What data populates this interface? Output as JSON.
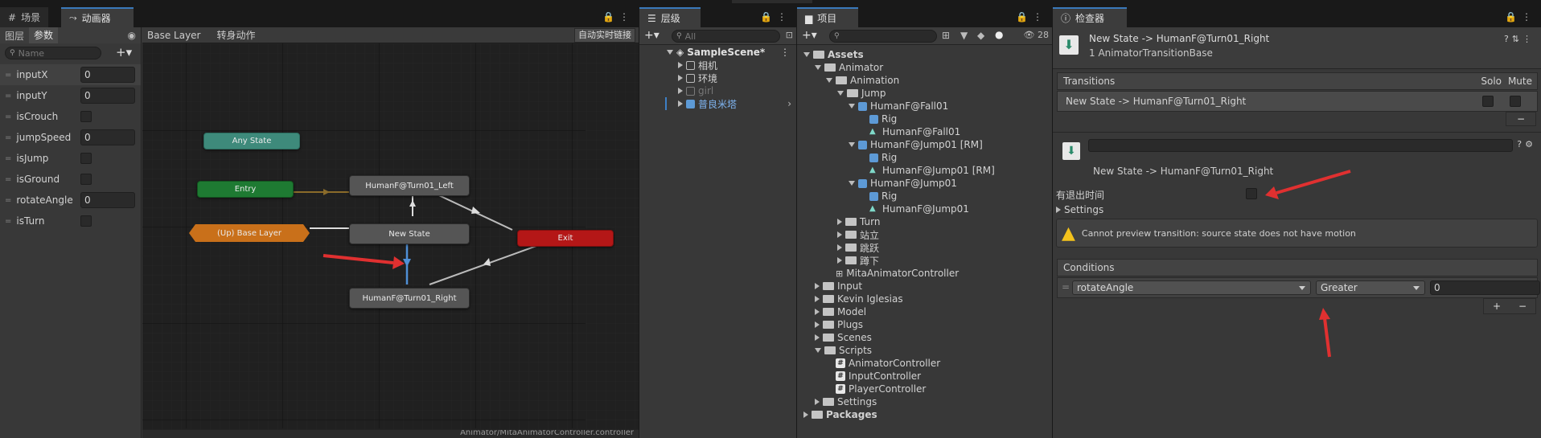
{
  "animator": {
    "tabs": [
      {
        "label": "场景"
      },
      {
        "label": "动画器"
      }
    ],
    "subtabs": {
      "layers": "图层",
      "params": "参数"
    },
    "search_placeholder": "Name",
    "params": [
      {
        "name": "inputX",
        "type": "float",
        "value": "0"
      },
      {
        "name": "inputY",
        "type": "float",
        "value": "0"
      },
      {
        "name": "isCrouch",
        "type": "bool",
        "value": ""
      },
      {
        "name": "jumpSpeed",
        "type": "float",
        "value": "0"
      },
      {
        "name": "isJump",
        "type": "bool",
        "value": ""
      },
      {
        "name": "isGround",
        "type": "bool",
        "value": ""
      },
      {
        "name": "rotateAngle",
        "type": "float",
        "value": "0"
      },
      {
        "name": "isTurn",
        "type": "bool",
        "value": ""
      }
    ],
    "breadcrumb": {
      "layer": "Base Layer",
      "state": "转身动作"
    },
    "live_link": "自动实时链接",
    "footer_path": "Animator/MitaAnimatorController.controller",
    "nodes": {
      "any_state": "Any State",
      "entry": "Entry",
      "up_base": "(Up) Base Layer",
      "turn_left": "HumanF@Turn01_Left",
      "new_state": "New State",
      "turn_right": "HumanF@Turn01_Right",
      "exit": "Exit"
    },
    "colors": {
      "any": "#3e8a7b",
      "entry": "#1e7a32",
      "up": "#c9701a",
      "exit": "#b41717",
      "state": "#555555",
      "selected": "#4f8fd6",
      "annotation": "#e03030"
    }
  },
  "hierarchy": {
    "tab": "层级",
    "search_placeholder": "All",
    "scene": "SampleScene*",
    "items": [
      {
        "label": "相机",
        "kind": "outline"
      },
      {
        "label": "环境",
        "kind": "outline"
      },
      {
        "label": "girl",
        "kind": "disabled"
      },
      {
        "label": "普良米塔",
        "kind": "prefab"
      }
    ]
  },
  "project": {
    "tab": "项目",
    "count": "28",
    "tree": [
      {
        "label": "Assets",
        "depth": 0,
        "icon": "folder",
        "expanded": true
      },
      {
        "label": "Animator",
        "depth": 1,
        "icon": "folder",
        "expanded": true
      },
      {
        "label": "Animation",
        "depth": 2,
        "icon": "folder",
        "expanded": true
      },
      {
        "label": "Jump",
        "depth": 3,
        "icon": "folder",
        "expanded": true
      },
      {
        "label": "HumanF@Fall01",
        "depth": 4,
        "icon": "cube",
        "expanded": true
      },
      {
        "label": "Rig",
        "depth": 5,
        "icon": "cube",
        "expanded": null
      },
      {
        "label": "HumanF@Fall01",
        "depth": 5,
        "icon": "anim",
        "expanded": null
      },
      {
        "label": "HumanF@Jump01 [RM]",
        "depth": 4,
        "icon": "cube",
        "expanded": true
      },
      {
        "label": "Rig",
        "depth": 5,
        "icon": "cube",
        "expanded": null
      },
      {
        "label": "HumanF@Jump01 [RM]",
        "depth": 5,
        "icon": "anim",
        "expanded": null
      },
      {
        "label": "HumanF@Jump01",
        "depth": 4,
        "icon": "cube",
        "expanded": true
      },
      {
        "label": "Rig",
        "depth": 5,
        "icon": "cube",
        "expanded": null
      },
      {
        "label": "HumanF@Jump01",
        "depth": 5,
        "icon": "anim",
        "expanded": null
      },
      {
        "label": "Turn",
        "depth": 3,
        "icon": "folder",
        "expanded": false
      },
      {
        "label": "站立",
        "depth": 3,
        "icon": "folder",
        "expanded": false
      },
      {
        "label": "跳跃",
        "depth": 3,
        "icon": "folder",
        "expanded": false
      },
      {
        "label": "蹲下",
        "depth": 3,
        "icon": "folder",
        "expanded": false
      },
      {
        "label": "MitaAnimatorController",
        "depth": 2,
        "icon": "controller",
        "expanded": null
      },
      {
        "label": "Input",
        "depth": 1,
        "icon": "folder",
        "expanded": false
      },
      {
        "label": "Kevin Iglesias",
        "depth": 1,
        "icon": "folder",
        "expanded": false
      },
      {
        "label": "Model",
        "depth": 1,
        "icon": "folder",
        "expanded": false
      },
      {
        "label": "Plugs",
        "depth": 1,
        "icon": "folder",
        "expanded": false
      },
      {
        "label": "Scenes",
        "depth": 1,
        "icon": "folder",
        "expanded": false
      },
      {
        "label": "Scripts",
        "depth": 1,
        "icon": "folder",
        "expanded": true
      },
      {
        "label": "AnimatorController",
        "depth": 2,
        "icon": "script",
        "expanded": null
      },
      {
        "label": "InputController",
        "depth": 2,
        "icon": "script",
        "expanded": null
      },
      {
        "label": "PlayerController",
        "depth": 2,
        "icon": "script",
        "expanded": null
      },
      {
        "label": "Settings",
        "depth": 1,
        "icon": "folder",
        "expanded": false
      },
      {
        "label": "Packages",
        "depth": 0,
        "icon": "folder",
        "expanded": false
      }
    ]
  },
  "inspector": {
    "tab": "检查器",
    "title": "New State -> HumanF@Turn01_Right",
    "subtitle": "1 AnimatorTransitionBase",
    "transitions_header": "Transitions",
    "solo": "Solo",
    "mute": "Mute",
    "transition_row": "New State -> HumanF@Turn01_Right",
    "transition_name": "New State -> HumanF@Turn01_Right",
    "has_exit_time_label": "有退出时间",
    "settings_label": "Settings",
    "warning": "Cannot preview transition: source state does not have motion",
    "conditions_header": "Conditions",
    "condition": {
      "param": "rotateAngle",
      "op": "Greater",
      "value": "0"
    }
  }
}
